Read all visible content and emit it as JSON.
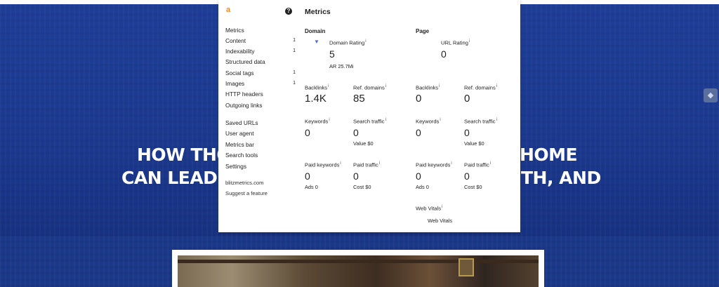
{
  "hero": {
    "line1_left": "HOW THO",
    "line1_right": "HOME",
    "line2_left": "CAN LEAD",
    "line2_right": "TH, AND"
  },
  "icons": {
    "extension_icon": "dropbox-icon",
    "logo": "ahrefs-logo-icon",
    "help": "help-icon"
  },
  "colors": {
    "background": "#1f3f97",
    "accent": "#f08a24"
  },
  "popup": {
    "logo_text": "a",
    "help_text": "?",
    "title": "Metrics",
    "nav": [
      {
        "label": "Metrics",
        "count": ""
      },
      {
        "label": "Content",
        "count": "1"
      },
      {
        "label": "Indexability",
        "count": "1"
      },
      {
        "label": "Structured data",
        "count": ""
      },
      {
        "label": "Social tags",
        "count": "1"
      },
      {
        "label": "Images",
        "count": "1"
      },
      {
        "label": "HTTP headers",
        "count": ""
      },
      {
        "label": "Outgoing links",
        "count": ""
      }
    ],
    "tools": [
      "Saved URLs",
      "User agent",
      "Metrics bar",
      "Search tools",
      "Settings"
    ],
    "footer": {
      "site": "blitzmetrics.com",
      "suggest": "Suggest a feature"
    },
    "domain": {
      "heading": "Domain",
      "domain_rating_label": "Domain Rating",
      "domain_rating_value": "5",
      "ar": "AR 25.7M",
      "backlinks_label": "Backlinks",
      "backlinks_value": "1.4K",
      "ref_domains_label": "Ref. domains",
      "ref_domains_value": "85",
      "keywords_label": "Keywords",
      "keywords_value": "0",
      "search_traffic_label": "Search traffic",
      "search_traffic_value": "0",
      "search_traffic_sub": "Value $0",
      "paid_keywords_label": "Paid keywords",
      "paid_keywords_value": "0",
      "paid_keywords_sub": "Ads 0",
      "paid_traffic_label": "Paid traffic",
      "paid_traffic_value": "0",
      "paid_traffic_sub": "Cost $0"
    },
    "page": {
      "heading": "Page",
      "url_rating_label": "URL Rating",
      "url_rating_value": "0",
      "backlinks_label": "Backlinks",
      "backlinks_value": "0",
      "ref_domains_label": "Ref. domains",
      "ref_domains_value": "0",
      "keywords_label": "Keywords",
      "keywords_value": "0",
      "search_traffic_label": "Search traffic",
      "search_traffic_value": "0",
      "search_traffic_sub": "Value $0",
      "paid_keywords_label": "Paid keywords",
      "paid_keywords_value": "0",
      "paid_keywords_sub": "Ads 0",
      "paid_traffic_label": "Paid traffic",
      "paid_traffic_value": "0",
      "paid_traffic_sub": "Cost $0",
      "web_vitals_label": "Web Vitals",
      "web_vitals_value": "Web Vitals"
    }
  }
}
